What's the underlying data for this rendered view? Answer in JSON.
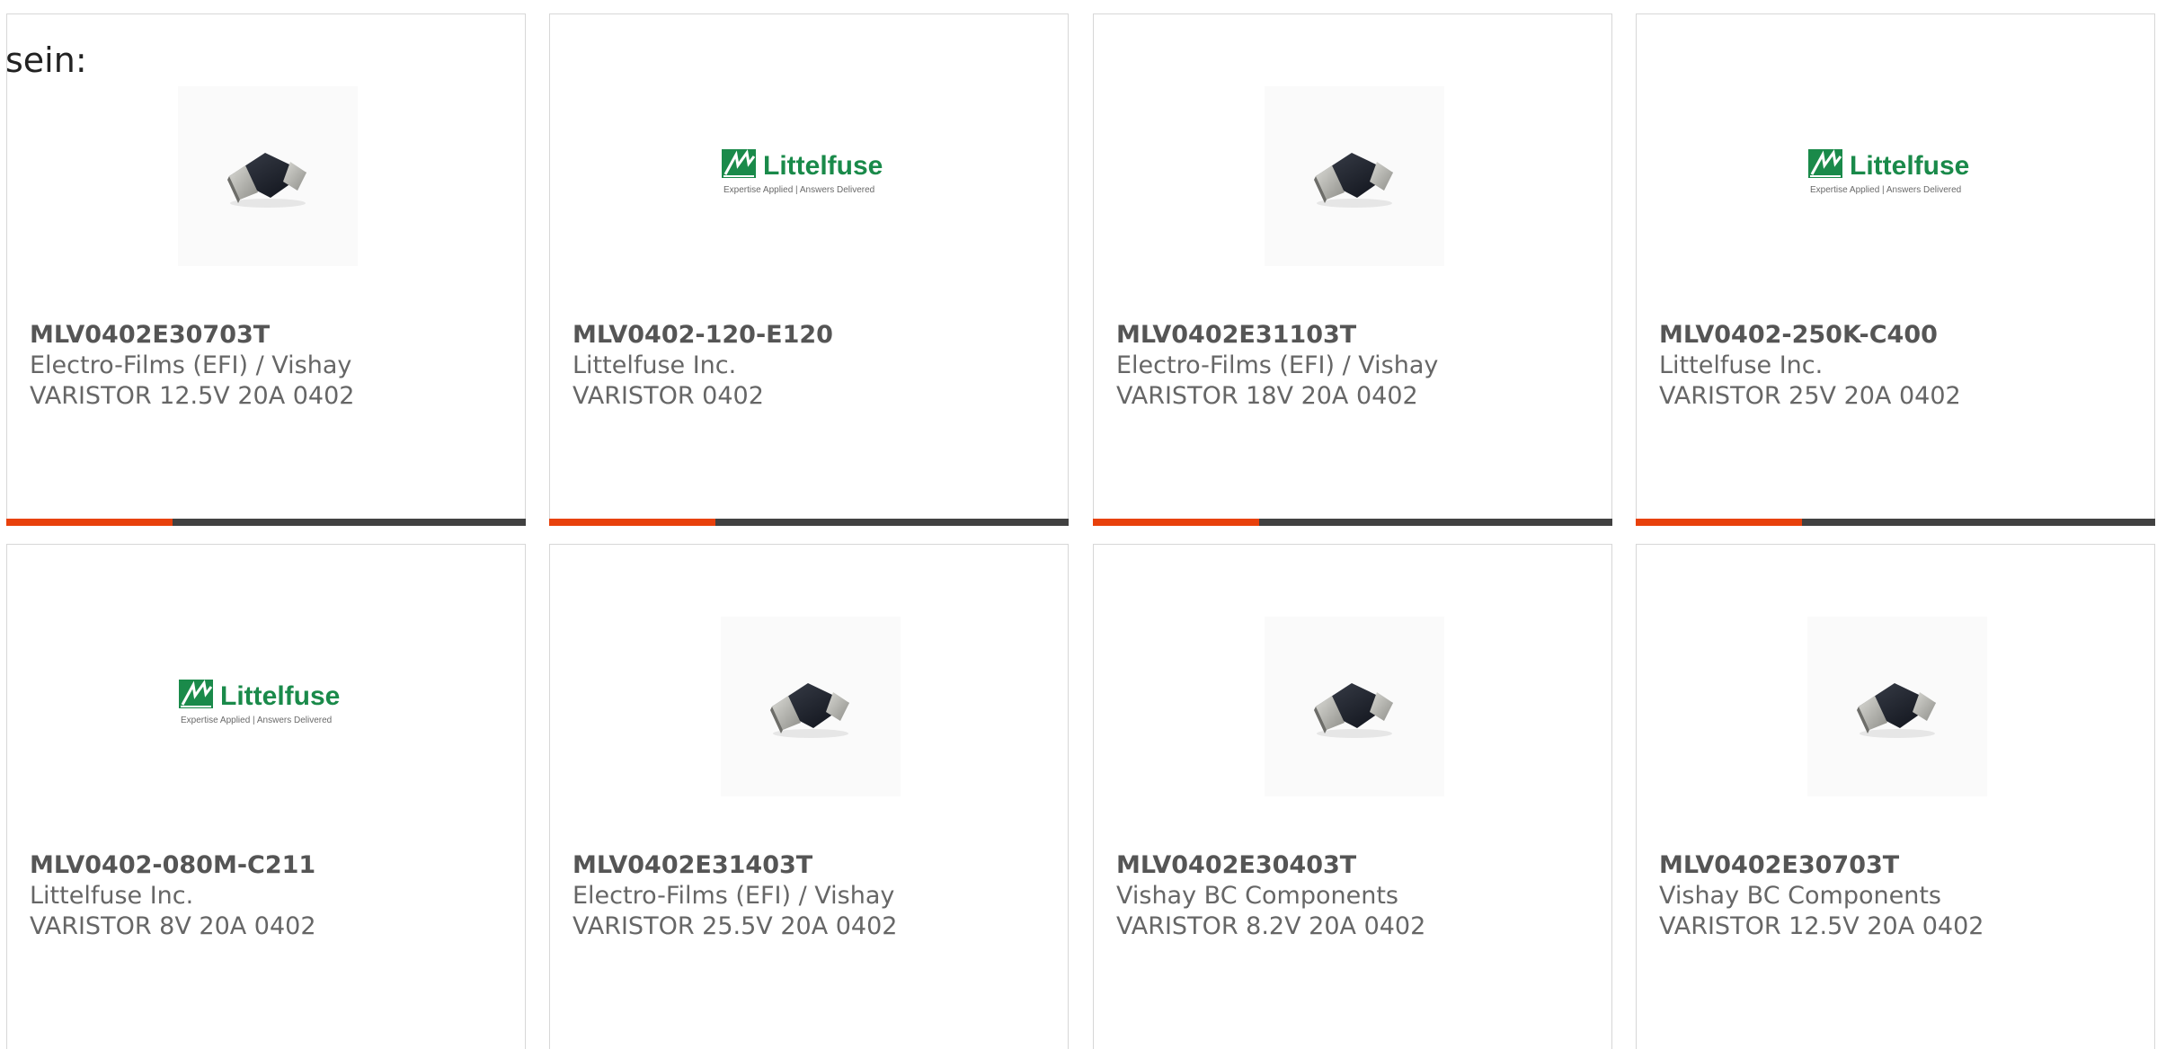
{
  "intro_text": "sein:",
  "accent_color": "#e8410c",
  "bar_track_color": "#414141",
  "cards": [
    {
      "image": "chip",
      "part": "MLV0402E30703T",
      "manufacturer": "Electro-Films (EFI) / Vishay",
      "description": "VARISTOR 12.5V 20A 0402",
      "progress": 0.32
    },
    {
      "image": "littelfuse-logo",
      "part": "MLV0402-120-E120",
      "manufacturer": "Littelfuse Inc.",
      "description": "VARISTOR 0402",
      "progress": 0.32
    },
    {
      "image": "chip",
      "part": "MLV0402E31103T",
      "manufacturer": "Electro-Films (EFI) / Vishay",
      "description": "VARISTOR 18V 20A 0402",
      "progress": 0.32
    },
    {
      "image": "littelfuse-logo",
      "part": "MLV0402-250K-C400",
      "manufacturer": "Littelfuse Inc.",
      "description": "VARISTOR 25V 20A 0402",
      "progress": 0.32
    },
    {
      "image": "littelfuse-logo",
      "part": "MLV0402-080M-C211",
      "manufacturer": "Littelfuse Inc.",
      "description": "VARISTOR 8V 20A 0402"
    },
    {
      "image": "chip",
      "part": "MLV0402E31403T",
      "manufacturer": "Electro-Films (EFI) / Vishay",
      "description": "VARISTOR 25.5V 20A 0402"
    },
    {
      "image": "chip",
      "part": "MLV0402E30403T",
      "manufacturer": "Vishay BC Components",
      "description": "VARISTOR 8.2V 20A 0402"
    },
    {
      "image": "chip",
      "part": "MLV0402E30703T",
      "manufacturer": "Vishay BC Components",
      "description": "VARISTOR 12.5V 20A 0402"
    }
  ],
  "logo": {
    "name": "Littelfuse",
    "tagline": "Expertise Applied | Answers Delivered",
    "color": "#1a8a4a"
  }
}
